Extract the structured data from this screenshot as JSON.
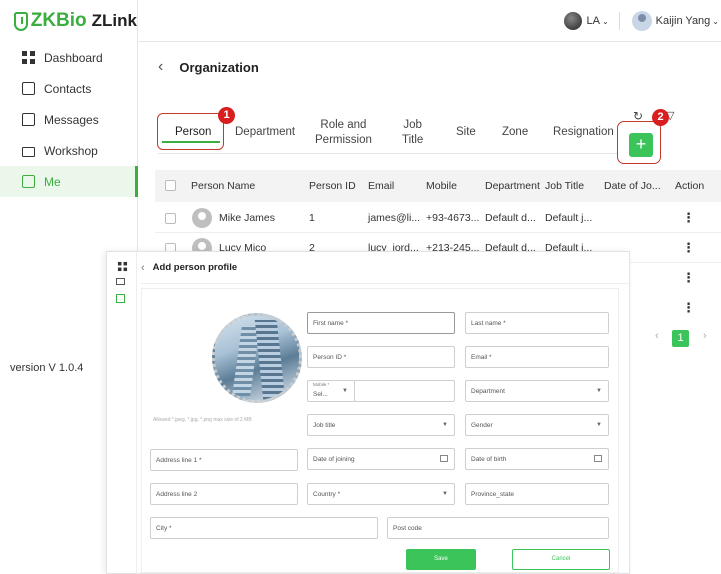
{
  "brand": {
    "logo_main": "ZKBio",
    "logo_sub": "ZLink"
  },
  "sidebar": {
    "items": [
      {
        "label": "Dashboard",
        "icon": "dashboard-icon"
      },
      {
        "label": "Contacts",
        "icon": "contacts-icon"
      },
      {
        "label": "Messages",
        "icon": "messages-icon"
      },
      {
        "label": "Workshop",
        "icon": "workshop-icon"
      },
      {
        "label": "Me",
        "icon": "me-icon",
        "active": true
      }
    ],
    "version": "version V 1.0.4"
  },
  "header": {
    "language": "LA",
    "user_name": "Kaijin Yang"
  },
  "page": {
    "title": "Organization"
  },
  "tabs": [
    "Person",
    "Department",
    "Role and Permission",
    "Job Title",
    "Site",
    "Zone",
    "Resignation"
  ],
  "tabs_display": {
    "role": [
      "Role and",
      "Permission"
    ],
    "job": [
      "Job",
      "Title"
    ]
  },
  "badges": {
    "one": "1",
    "two": "2"
  },
  "table": {
    "columns": [
      "Person Name",
      "Person ID",
      "Email",
      "Mobile",
      "Department",
      "Job Title",
      "Date of Jo...",
      "Action"
    ],
    "rows": [
      {
        "name": "Mike James",
        "id": "1",
        "email": "james@li...",
        "mobile": "+93-4673...",
        "dept": "Default d...",
        "job": "Default j..."
      },
      {
        "name": "Lucy Mico",
        "id": "2",
        "email": "lucy_jord...",
        "mobile": "+213-245...",
        "dept": "Default d...",
        "job": "Default j..."
      }
    ]
  },
  "pagination": {
    "current": "1"
  },
  "modal": {
    "title": "Add person profile",
    "photo_hint": "Allowed *.jpeg, *.jpg, *.png max size of 2 MB",
    "fields": {
      "first_name": "First name *",
      "last_name": "Last name *",
      "person_id": "Person ID *",
      "email": "Email *",
      "mobile_label": "Mobile *",
      "mobile_code": "Sel...",
      "department": "Department",
      "job_title": "Job title",
      "gender": "Gender",
      "address1": "Address line 1 *",
      "date_joining": "Date of joining",
      "date_birth": "Date of birth",
      "address2": "Address line 2",
      "country": "Country *",
      "province": "Province_state",
      "city": "City *",
      "post_code": "Post code"
    },
    "save": "Save",
    "cancel": "Cancel"
  }
}
